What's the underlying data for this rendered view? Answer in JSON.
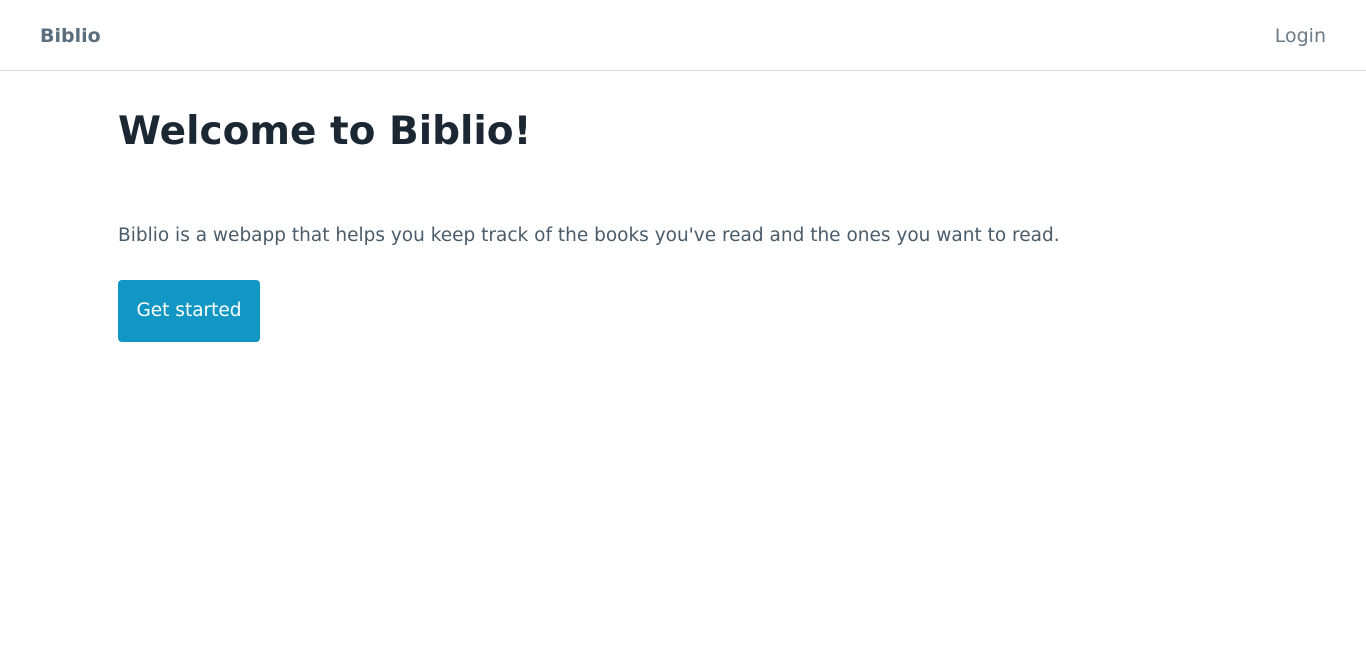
{
  "header": {
    "brand": "Biblio",
    "login_label": "Login"
  },
  "hero": {
    "title": "Welcome to Biblio!",
    "description": "Biblio is a webapp that helps you keep track of the books you've read and the ones you want to read.",
    "cta_label": "Get started"
  },
  "colors": {
    "accent": "#1296c3",
    "heading": "#1b2733",
    "body_text": "#4a5b69",
    "nav_text": "#5a6e7d",
    "border": "#d7dadd"
  }
}
